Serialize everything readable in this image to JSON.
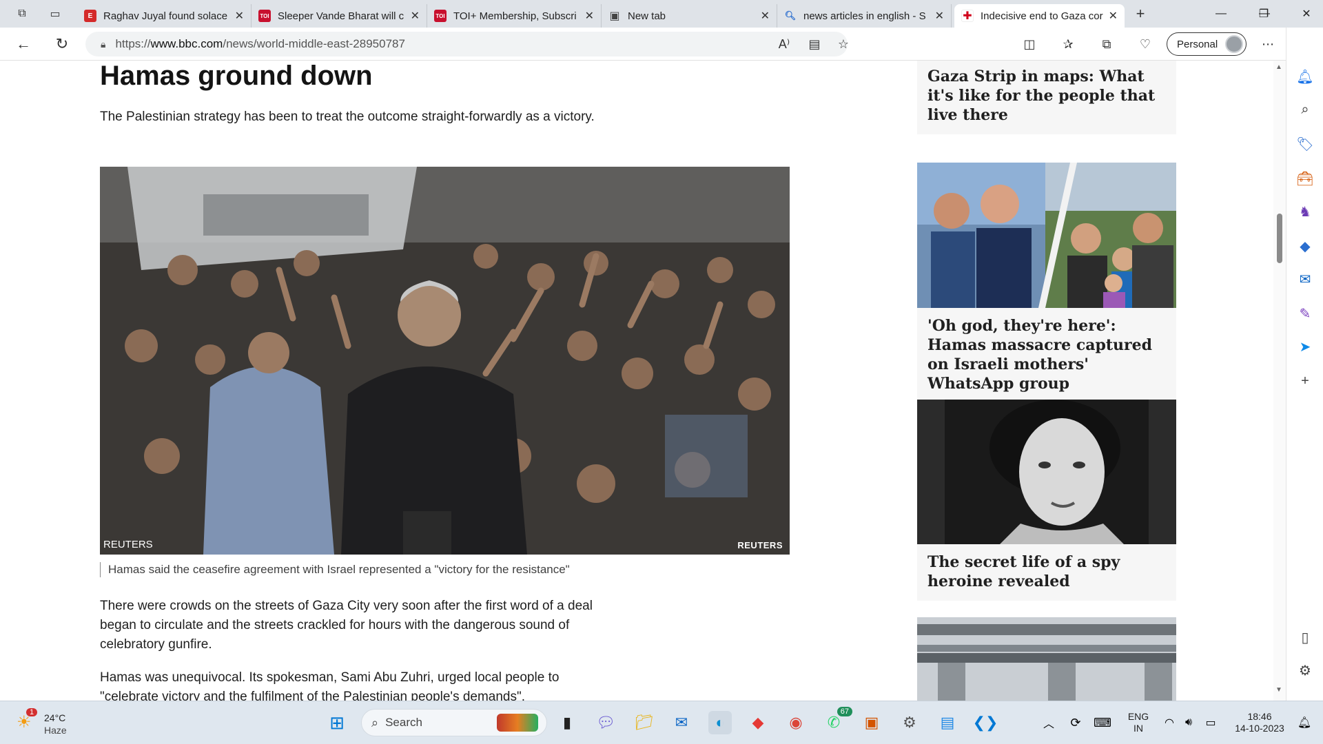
{
  "browser": {
    "tabs": [
      {
        "title": "Raghav Juyal found solace",
        "fav": "E",
        "fav_color": "#d42a2a"
      },
      {
        "title": "Sleeper Vande Bharat will c",
        "fav": "TOI",
        "fav_color": "#c8102e"
      },
      {
        "title": "TOI+ Membership, Subscri",
        "fav": "TOI",
        "fav_color": "#c8102e"
      },
      {
        "title": "New tab",
        "fav": "▣",
        "fav_color": "#555555"
      },
      {
        "title": "news articles in english - S",
        "fav": "🔍",
        "fav_color": "#2b6ecf"
      },
      {
        "title": "Indecisive end to Gaza cor",
        "fav": "✚",
        "fav_color": "#d0021b"
      }
    ],
    "url_prefix": "https://",
    "url_domain": "www.bbc.com",
    "url_path": "/news/world-middle-east-28950787",
    "profile_label": "Personal"
  },
  "article": {
    "headline": "Hamas ground down",
    "paragraph1": "The Palestinian strategy has been to treat the outcome straight-forwardly as a victory.",
    "photo_credit_left": "REUTERS",
    "photo_credit_right": "REUTERS",
    "caption": "Hamas said the ceasefire agreement with Israel represented a \"victory for the resistance\"",
    "paragraph2": "There were crowds on the streets of Gaza City very soon after the first word of a deal began to circulate and the streets crackled for hours with the dangerous sound of celebratory gunfire.",
    "paragraph3": "Hamas was unequivocal. Its spokesman, Sami Abu Zuhri, urged local people to \"celebrate victory and the fulfilment of the Palestinian people's demands\"."
  },
  "sidebar": {
    "stories": [
      {
        "title": "Gaza Strip in maps: What it's like for the people that live there"
      },
      {
        "title": "'Oh god, they're here': Hamas massacre captured on Israeli mothers' WhatsApp group"
      },
      {
        "title": "The secret life of a spy heroine revealed"
      }
    ]
  },
  "taskbar": {
    "weather_temp": "24°C",
    "weather_desc": "Haze",
    "weather_alert_count": "1",
    "search_placeholder": "Search",
    "whatsapp_badge": "67",
    "lang_line1": "ENG",
    "lang_line2": "IN",
    "time": "18:46",
    "date": "14-10-2023"
  }
}
